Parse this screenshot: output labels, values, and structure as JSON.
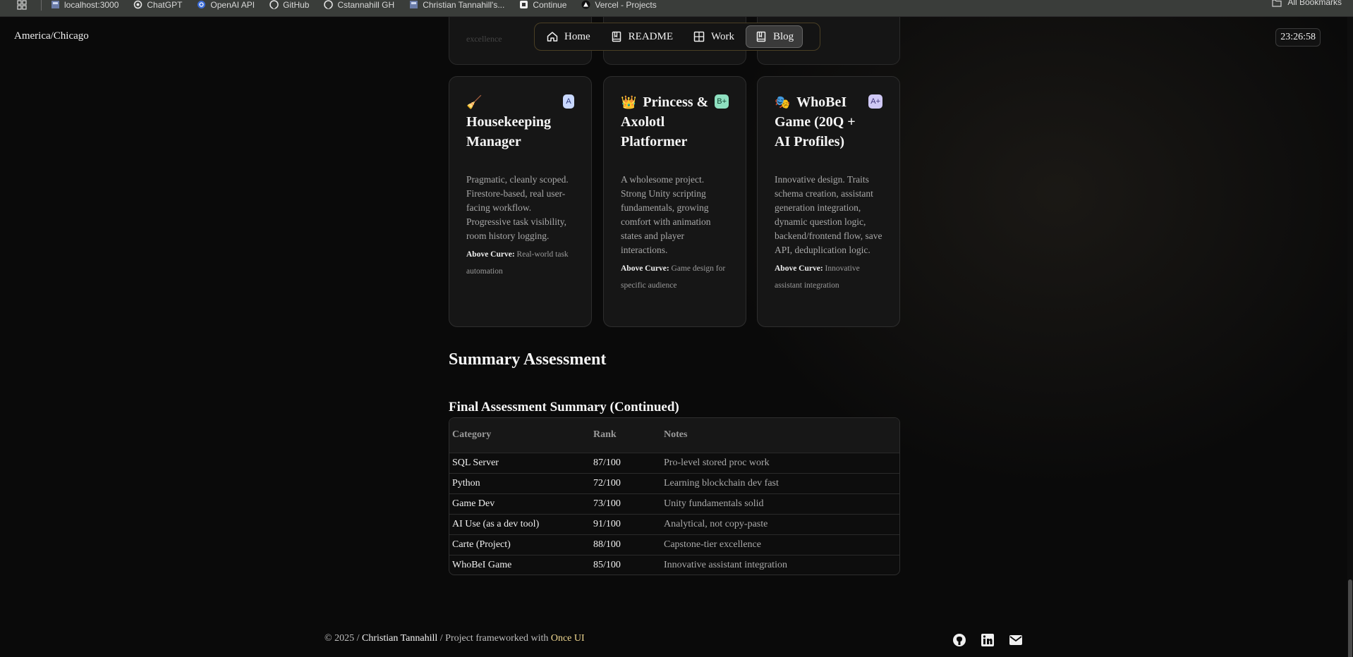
{
  "bookmarks": [
    {
      "label": "localhost:3000",
      "icon": "page-icon"
    },
    {
      "label": "ChatGPT",
      "icon": "openai-icon"
    },
    {
      "label": "OpenAI API",
      "icon": "openai-icon"
    },
    {
      "label": "GitHub",
      "icon": "github-icon"
    },
    {
      "label": "Cstannahill GH",
      "icon": "github-icon"
    },
    {
      "label": "Christian Tannahill's...",
      "icon": "page-icon"
    },
    {
      "label": "Continue",
      "icon": "continue-icon"
    },
    {
      "label": "Vercel - Projects",
      "icon": "vercel-icon"
    }
  ],
  "bookmarks_right": "All Bookmarks",
  "timezone": "America/Chicago",
  "clock": "23:26:58",
  "nav": [
    {
      "label": "Home",
      "icon": "home-icon"
    },
    {
      "label": "README",
      "icon": "book-icon"
    },
    {
      "label": "Work",
      "icon": "grid-icon"
    },
    {
      "label": "Blog",
      "icon": "book-icon",
      "active": true
    }
  ],
  "stub_text": "excellence",
  "cards": [
    {
      "emoji": "🧹",
      "title": "Housekeeping Manager",
      "grade": "A",
      "desc": "Pragmatic, cleanly scoped. Firestore-based, real user-facing workflow. Progressive task visibility, room history logging.",
      "curve_label": "Above Curve:",
      "curve_text": "Real-world task automation"
    },
    {
      "emoji": "👑",
      "title": "Princess & Axolotl Platformer",
      "grade": "B+",
      "desc": "A wholesome project. Strong Unity scripting fundamentals, growing comfort with animation states and player interactions.",
      "curve_label": "Above Curve:",
      "curve_text": "Game design for specific audience"
    },
    {
      "emoji": "🎭",
      "title": "WhoBeI Game (20Q + AI Profiles)",
      "grade": "A+",
      "desc": "Innovative design. Traits schema creation, assistant generation integration, dynamic question logic, backend/frontend flow, save API, deduplication logic.",
      "curve_label": "Above Curve:",
      "curve_text": "Innovative assistant integration"
    }
  ],
  "summary_heading": "Summary Assessment",
  "final_heading": "Final Assessment Summary (Continued)",
  "table": {
    "headers": [
      "Category",
      "Rank",
      "Notes"
    ],
    "rows": [
      [
        "SQL Server",
        "87/100",
        "Pro-level stored proc work"
      ],
      [
        "Python",
        "72/100",
        "Learning blockchain dev fast"
      ],
      [
        "Game Dev",
        "73/100",
        "Unity fundamentals solid"
      ],
      [
        "AI Use (as a dev tool)",
        "91/100",
        "Analytical, not copy-paste"
      ],
      [
        "Carte (Project)",
        "88/100",
        "Capstone-tier excellence"
      ],
      [
        "WhoBeI Game",
        "85/100",
        "Innovative assistant integration"
      ]
    ]
  },
  "footer": {
    "prefix": "© 2025 /",
    "name": "Christian Tannahill",
    "middle": "/ Project frameworked with",
    "link": "Once UI"
  },
  "social": [
    "github-icon",
    "linkedin-icon",
    "mail-icon"
  ]
}
